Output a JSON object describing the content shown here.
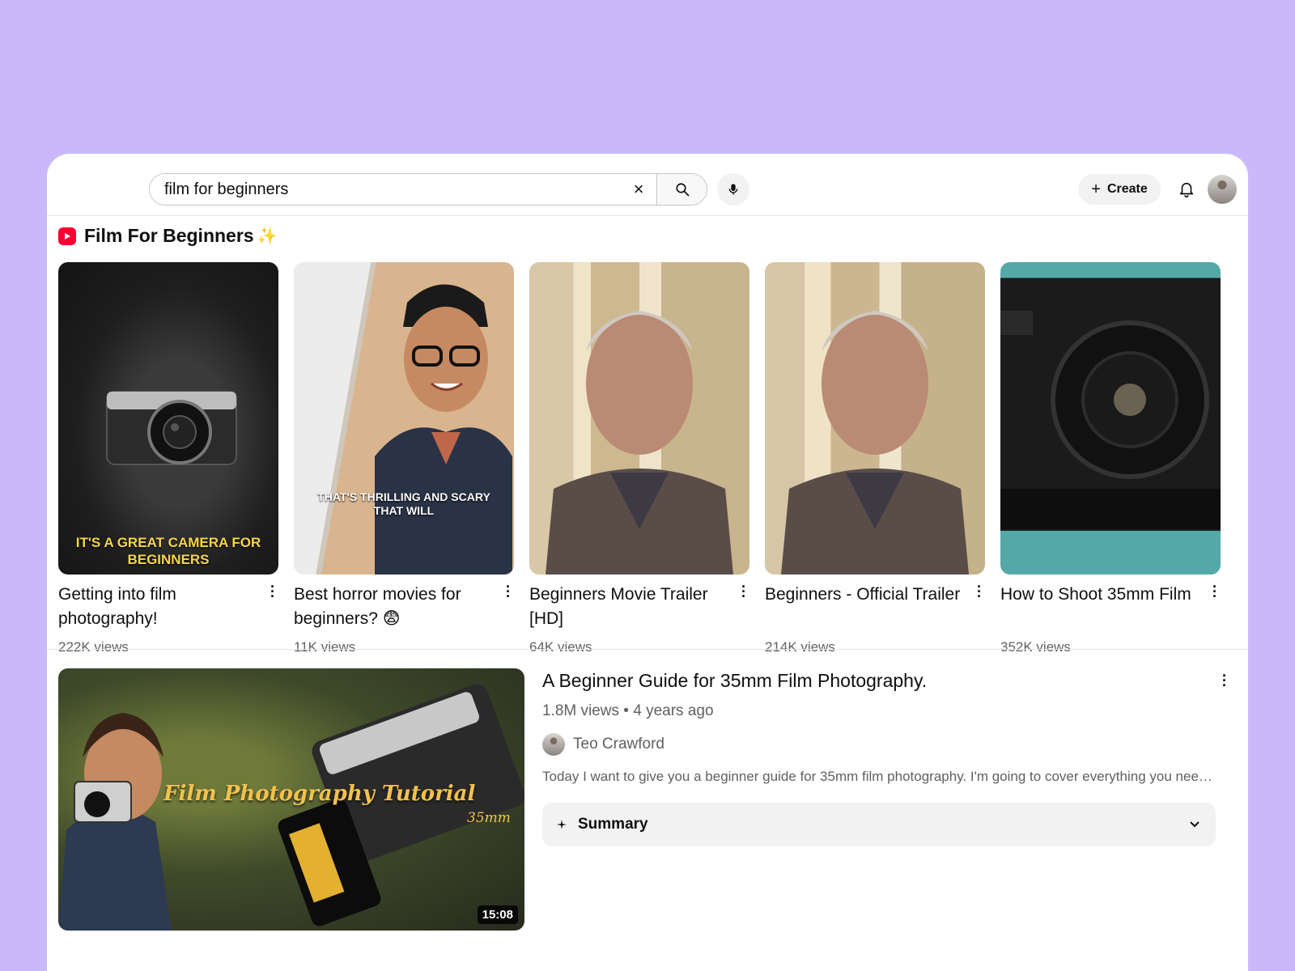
{
  "search": {
    "query": "film for beginners",
    "clear": "×"
  },
  "header": {
    "create_label": "Create",
    "create_plus": "+"
  },
  "shorts": {
    "title": "Film For Beginners",
    "sparkle": "✨",
    "items": [
      {
        "title": "Getting into film photography!",
        "views": "222K views",
        "caption": "IT'S A GREAT CAMERA FOR BEGINNERS"
      },
      {
        "title": "Best horror movies for beginners? 😨",
        "views": "11K views",
        "caption": "THAT'S THRILLING AND SCARY THAT WILL"
      },
      {
        "title": "Beginners Movie Trailer [HD]",
        "views": "64K views"
      },
      {
        "title": "Beginners - Official Trailer",
        "views": "214K views"
      },
      {
        "title": "How to Shoot 35mm Film",
        "views": "352K views"
      }
    ]
  },
  "featured": {
    "title": "A Beginner Guide for 35mm Film Photography.",
    "stats": "1.8M views • 4 years ago",
    "channel": "Teo Crawford",
    "description": "Today I want to give you a beginner guide for 35mm film photography. I'm going to cover everything you need to know",
    "summary_label": "Summary",
    "duration": "15:08",
    "overlay_title": "Film Photography Tutorial",
    "overlay_mm": "35mm"
  },
  "colors": {
    "background": "#c9b9fb",
    "brand_red": "#ff0033",
    "caption_yellow": "#f7d64a"
  }
}
